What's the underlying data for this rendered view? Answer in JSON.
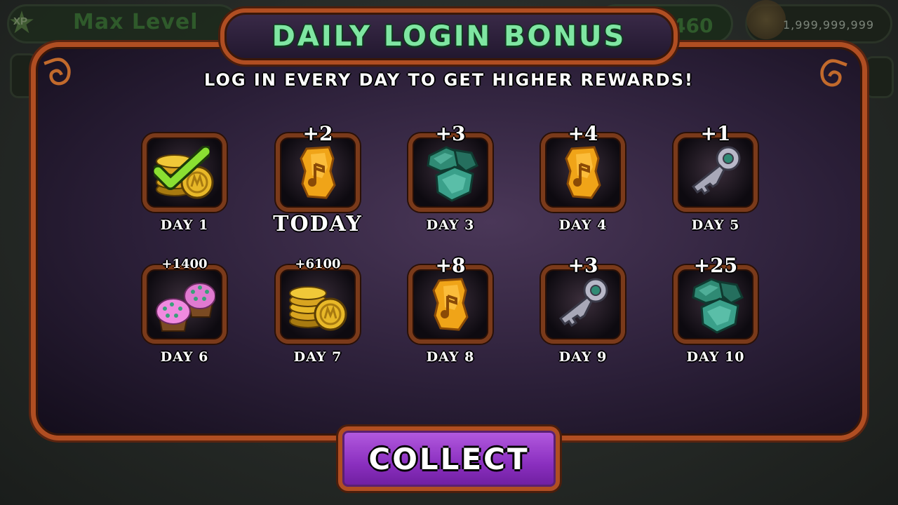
{
  "hud": {
    "xp_label": "XP",
    "level_text": "Max Level",
    "mid_value": "460",
    "currency_value": "1,999,999,999"
  },
  "dialog": {
    "title": "DAILY LOGIN BONUS",
    "subtitle": "LOG IN EVERY DAY TO GET HIGHER REWARDS!",
    "collect_label": "COLLECT"
  },
  "rewards": [
    {
      "day": "DAY 1",
      "amount": "",
      "item": "coins",
      "collected": true
    },
    {
      "day": "TODAY",
      "amount": "+2",
      "item": "shard-gold",
      "collected": false,
      "is_today": true
    },
    {
      "day": "DAY 3",
      "amount": "+3",
      "item": "diamonds",
      "collected": false
    },
    {
      "day": "DAY 4",
      "amount": "+4",
      "item": "shard-gold",
      "collected": false
    },
    {
      "day": "DAY 5",
      "amount": "+1",
      "item": "key",
      "collected": false
    },
    {
      "day": "DAY 6",
      "amount": "+1400",
      "item": "treats",
      "collected": false
    },
    {
      "day": "DAY 7",
      "amount": "+6100",
      "item": "coins",
      "collected": false
    },
    {
      "day": "DAY 8",
      "amount": "+8",
      "item": "shard-gold",
      "collected": false
    },
    {
      "day": "DAY 9",
      "amount": "+3",
      "item": "key",
      "collected": false
    },
    {
      "day": "DAY 10",
      "amount": "+25",
      "item": "diamonds",
      "collected": false
    }
  ],
  "colors": {
    "title_green": "#7fe6a2",
    "frame_orange": "#b04e22",
    "button_purple": "#8a2fbf"
  }
}
